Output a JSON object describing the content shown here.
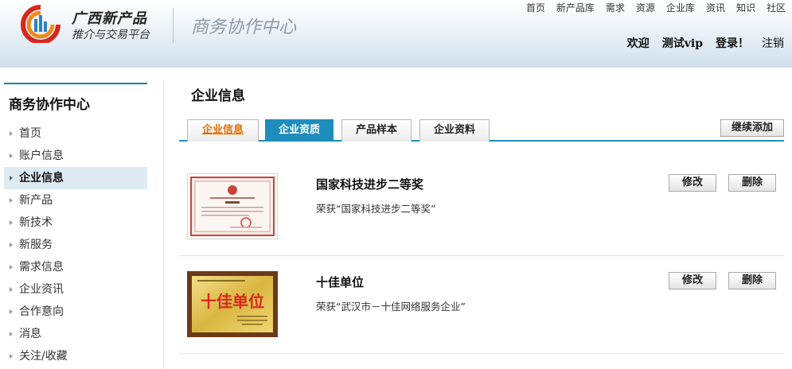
{
  "header": {
    "brand_name": "广西新产品",
    "brand_sub": "推介与交易平台",
    "center_title": "商务协作中心",
    "nav": [
      "首页",
      "新产品库",
      "需求",
      "资源",
      "企业库",
      "资讯",
      "知识",
      "社区"
    ],
    "user": {
      "welcome": "欢迎",
      "username": "测试vip",
      "login": "登录！",
      "logout": "注销"
    }
  },
  "sidebar": {
    "title": "商务协作中心",
    "items": [
      "首页",
      "账户信息",
      "企业信息",
      "新产品",
      "新技术",
      "新服务",
      "需求信息",
      "企业资讯",
      "合作意向",
      "消息",
      "关注/收藏"
    ],
    "active_index": 2
  },
  "main": {
    "title": "企业信息",
    "tabs": [
      "企业信息",
      "企业资质",
      "产品样本",
      "企业资料"
    ],
    "active_tab": 1,
    "add_button": "继续添加",
    "items": [
      {
        "title": "国家科技进步二等奖",
        "desc": "荣获“国家科技进步二等奖”",
        "edit": "修改",
        "delete": "删除"
      },
      {
        "title": "十佳单位",
        "desc": "荣获“武汉市－十佳网络服务企业”",
        "edit": "修改",
        "delete": "删除"
      }
    ],
    "plaque_text": "十佳单位"
  },
  "colors": {
    "accent": "#1e8dbd",
    "tab_link": "#e26a00",
    "logo_red": "#d6281d",
    "logo_orange": "#f08a1c",
    "plaque_gold": "#d9b640"
  }
}
